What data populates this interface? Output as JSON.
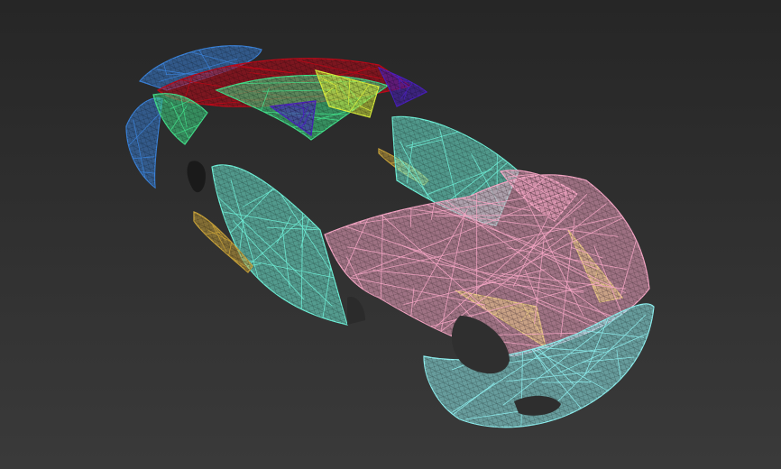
{
  "viewport": {
    "background_top": "#262626",
    "background_bottom": "#3a3a3a"
  },
  "model": {
    "type": "car-body-wireframe",
    "panel_colors": {
      "hood": "#f7a7c6",
      "front_bumper": "#8ff0f0",
      "side_panel_left": "#6ff0d8",
      "right_front_fender": "#6ff0d8",
      "roof_frame": "#42e08a",
      "rear_spoiler": "#3b82d8",
      "tail_section": "#c00818",
      "rear_quarter": "#4a1fbf",
      "mirror": "#d9ee3a",
      "sill": "#c8a23a"
    }
  }
}
